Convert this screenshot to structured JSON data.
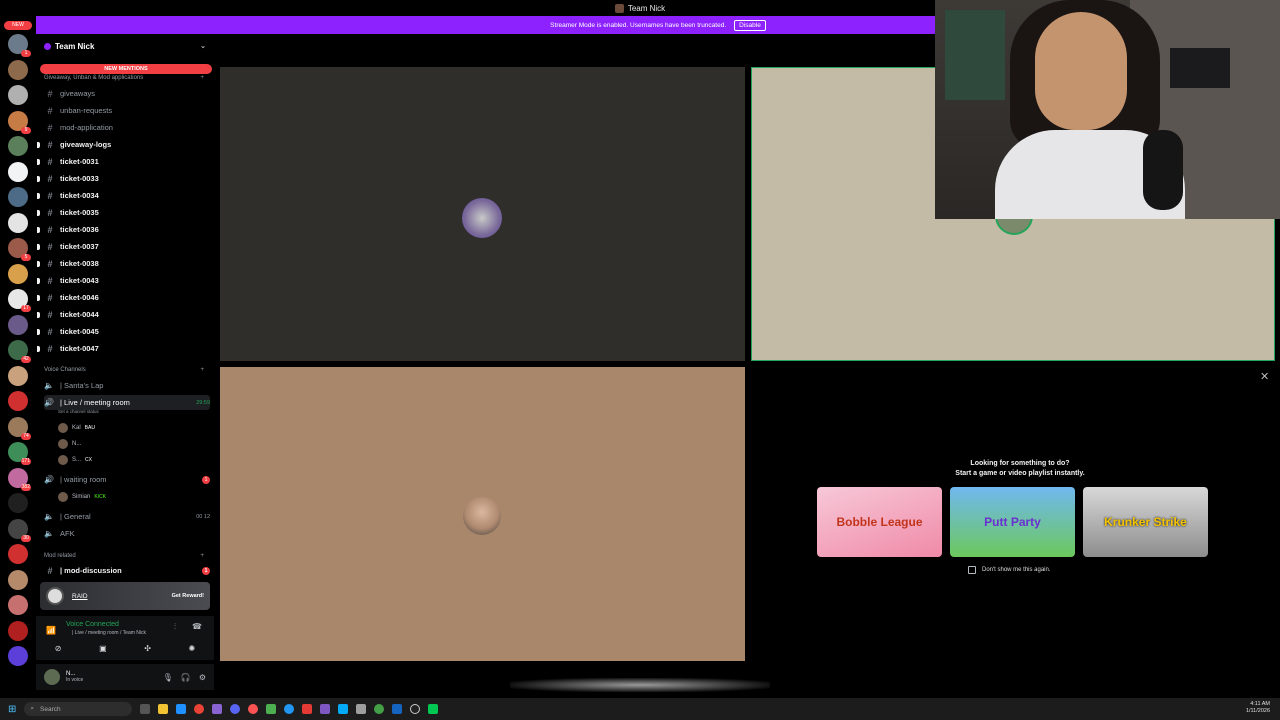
{
  "window": {
    "title": "Team Nick"
  },
  "banner": {
    "text": "Streamer Mode is enabled. Usernames have been truncated.",
    "button": "Disable"
  },
  "rail": {
    "new_label": "NEW",
    "servers": [
      {
        "color": "#6c7b8b",
        "badge": "1"
      },
      {
        "color": "#8d6a4b",
        "badge": ""
      },
      {
        "color": "#b0b0b0",
        "badge": ""
      },
      {
        "color": "#c77b45",
        "badge": "9"
      },
      {
        "color": "#5a7f5a",
        "badge": ""
      },
      {
        "color": "#f2f3f5",
        "badge": ""
      },
      {
        "color": "#4d6b86",
        "badge": ""
      },
      {
        "color": "#e4e4e4",
        "badge": ""
      },
      {
        "color": "#9b5a4a",
        "badge": "5"
      },
      {
        "color": "#d8a04a",
        "badge": ""
      },
      {
        "color": "#e8e8e8",
        "badge": "17"
      },
      {
        "color": "#6a5a8a",
        "badge": ""
      },
      {
        "color": "#3d6b4a",
        "badge": "42"
      },
      {
        "color": "#c9a27d",
        "badge": ""
      },
      {
        "color": "#d03030",
        "badge": ""
      },
      {
        "color": "#9a7a5a",
        "badge": "74"
      },
      {
        "color": "#3e8e5a",
        "badge": "171"
      },
      {
        "color": "#c06aa0",
        "badge": "382"
      },
      {
        "color": "#202020",
        "badge": ""
      },
      {
        "color": "#444",
        "badge": "30"
      },
      {
        "color": "#d03030",
        "badge": ""
      },
      {
        "color": "#b48a6a",
        "badge": ""
      },
      {
        "color": "#c77070",
        "badge": ""
      },
      {
        "color": "#b02020",
        "badge": ""
      },
      {
        "color": "#5b3fd8",
        "badge": ""
      }
    ]
  },
  "sidebar": {
    "guild": "Team Nick",
    "mentions": "NEW MENTIONS",
    "category1": "Giveaway, Unban & Mod applications",
    "text_channels": [
      {
        "name": "giveaways",
        "unread": false
      },
      {
        "name": "unban-requests",
        "unread": false
      },
      {
        "name": "mod-application",
        "unread": false
      },
      {
        "name": "giveaway-logs",
        "unread": true
      },
      {
        "name": "ticket-0031",
        "unread": true
      },
      {
        "name": "ticket-0033",
        "unread": true
      },
      {
        "name": "ticket-0034",
        "unread": true
      },
      {
        "name": "ticket-0035",
        "unread": true
      },
      {
        "name": "ticket-0036",
        "unread": true
      },
      {
        "name": "ticket-0037",
        "unread": true
      },
      {
        "name": "ticket-0038",
        "unread": true
      },
      {
        "name": "ticket-0043",
        "unread": true
      },
      {
        "name": "ticket-0046",
        "unread": true
      },
      {
        "name": "ticket-0044",
        "unread": true
      },
      {
        "name": "ticket-0045",
        "unread": true
      },
      {
        "name": "ticket-0047",
        "unread": true
      }
    ],
    "category2": "Voice Channels",
    "santas_lap": "| Santa's Lap",
    "live_room": "| Live / meeting room",
    "live_time": "29:59",
    "set_status": "Set a channel status",
    "live_users": [
      {
        "name": "Kal",
        "tag": "BAU"
      },
      {
        "name": "N...",
        "tag": ""
      },
      {
        "name": "S...",
        "tag": "CX"
      }
    ],
    "waiting_room": "| waiting room",
    "waiting_badge": "1",
    "waiting_user": {
      "name": "Simian",
      "tag": "KICK"
    },
    "general": "| General",
    "general_count": "00 12",
    "afk": "AFK",
    "category3": "Mod related",
    "mod_discussion": "| mod-discussion",
    "mod_badge": "1"
  },
  "raid": {
    "label": "RAID",
    "button": "Get Reward!"
  },
  "voice": {
    "status": "Voice Connected",
    "location": "| Live / meeting room / Team Nick"
  },
  "user": {
    "name": "N...",
    "status": "In voice"
  },
  "activity": {
    "title_line1": "Looking for something to do?",
    "title_line2": "Start a game or video playlist instantly.",
    "games": [
      "Bobble League",
      "Putt Party",
      "Krunker Strike"
    ],
    "checkbox": "Don't show me this again."
  },
  "taskbar": {
    "search": "Search",
    "time": "4:11 AM",
    "date": "1/11/2026"
  }
}
